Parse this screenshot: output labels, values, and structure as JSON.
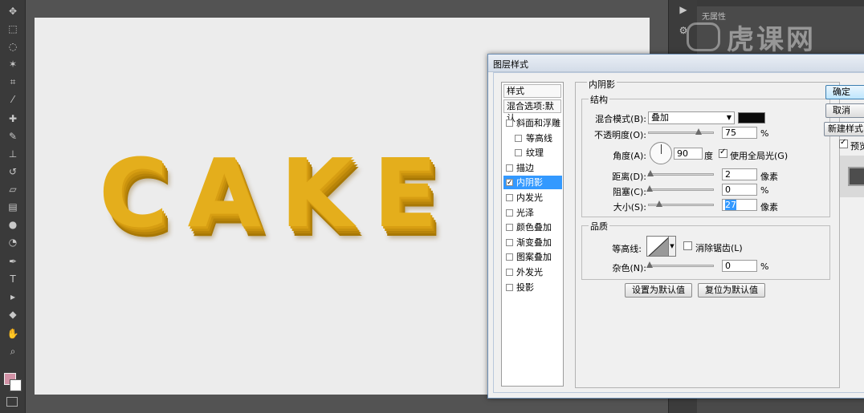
{
  "dialog": {
    "title": "图层样式",
    "buttons": {
      "ok": "确定",
      "cancel": "取消",
      "new_style": "新建样式",
      "preview": "预览"
    }
  },
  "styles_list": {
    "header": "样式",
    "blend_options": "混合选项:默认",
    "items": [
      {
        "label": "斜面和浮雕",
        "checked": false,
        "sub": false,
        "selected": false
      },
      {
        "label": "等高线",
        "checked": false,
        "sub": true,
        "selected": false
      },
      {
        "label": "纹理",
        "checked": false,
        "sub": true,
        "selected": false
      },
      {
        "label": "描边",
        "checked": false,
        "sub": false,
        "selected": false
      },
      {
        "label": "内阴影",
        "checked": true,
        "sub": false,
        "selected": true
      },
      {
        "label": "内发光",
        "checked": false,
        "sub": false,
        "selected": false
      },
      {
        "label": "光泽",
        "checked": false,
        "sub": false,
        "selected": false
      },
      {
        "label": "颜色叠加",
        "checked": false,
        "sub": false,
        "selected": false
      },
      {
        "label": "渐变叠加",
        "checked": false,
        "sub": false,
        "selected": false
      },
      {
        "label": "图案叠加",
        "checked": false,
        "sub": false,
        "selected": false
      },
      {
        "label": "外发光",
        "checked": false,
        "sub": false,
        "selected": false
      },
      {
        "label": "投影",
        "checked": false,
        "sub": false,
        "selected": false
      }
    ]
  },
  "inner_shadow": {
    "section_title": "内阴影",
    "structure_title": "结构",
    "blend_mode_label": "混合模式(B):",
    "blend_mode_value": "叠加",
    "shadow_color": "#0b0b0b",
    "opacity_label": "不透明度(O):",
    "opacity_value": "75",
    "opacity_unit": "%",
    "angle_label": "角度(A):",
    "angle_value": "90",
    "angle_unit": "度",
    "global_light_label": "使用全局光(G)",
    "global_light_checked": true,
    "distance_label": "距离(D):",
    "distance_value": "2",
    "distance_unit": "像素",
    "choke_label": "阻塞(C):",
    "choke_value": "0",
    "choke_unit": "%",
    "size_label": "大小(S):",
    "size_value": "27",
    "size_unit": "像素",
    "quality_title": "品质",
    "contour_label": "等高线:",
    "antialias_label": "消除锯齿(L)",
    "antialias_checked": false,
    "noise_label": "杂色(N):",
    "noise_value": "0",
    "noise_unit": "%",
    "set_default": "设置为默认值",
    "reset_default": "复位为默认值"
  },
  "canvas": {
    "text": "CAKE",
    "text_color": "#e4ae1c"
  },
  "right_panel": {
    "label": "无属性",
    "watermark": "虎课网"
  },
  "colors": {
    "foreground": "#d292a6",
    "background": "#ffffff"
  }
}
